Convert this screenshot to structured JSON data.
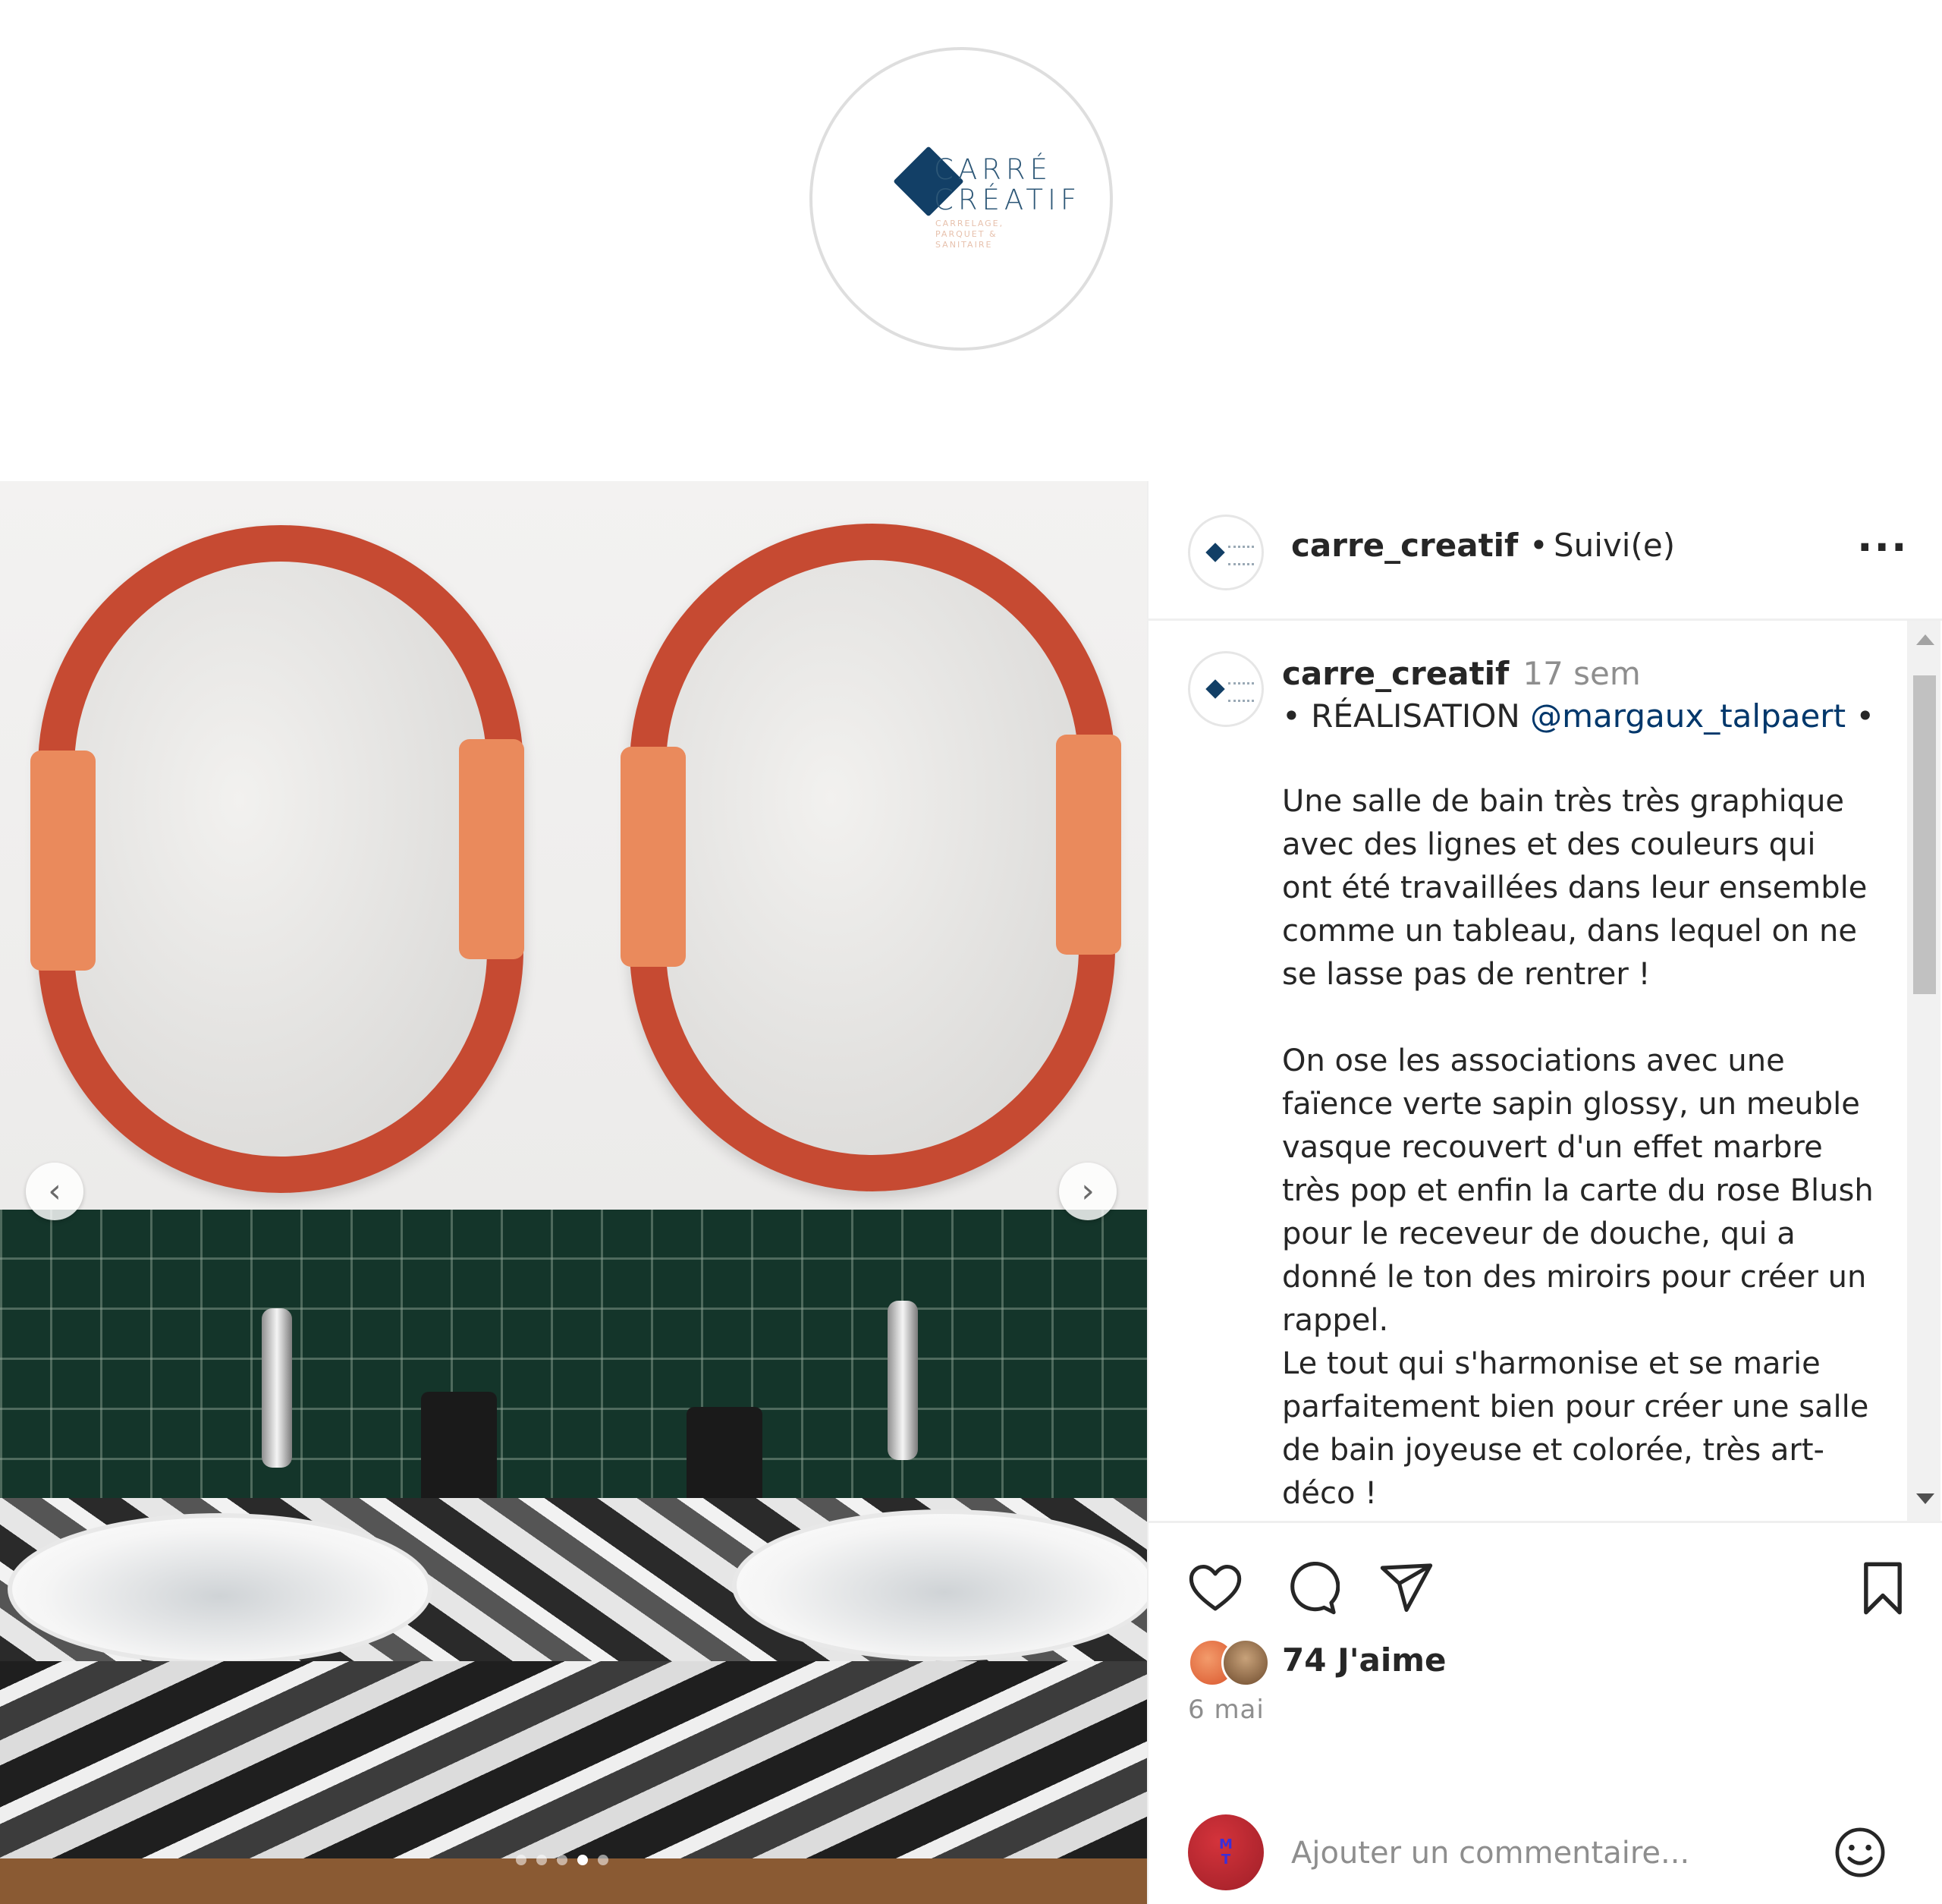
{
  "brand": {
    "logo_line1": "CARRÉ",
    "logo_line2": "CRÉATIF",
    "logo_sub": "CARRELAGE, PARQUET & SANITAIRE",
    "accent": "#123f66"
  },
  "post": {
    "username": "carre_creatif",
    "separator": "•",
    "follow_status": "Suivi(e)",
    "more": "...",
    "slides_total": 5,
    "slide_active": 4
  },
  "caption": {
    "username": "carre_creatif",
    "time": "17 sem",
    "line1_pre": "• RÉALISATION ",
    "mention": "@margaux_talpaert",
    "line1_post": " •",
    "p1": "Une salle de bain très très graphique avec des lignes et des couleurs qui ont été travaillées dans leur ensemble comme un tableau, dans lequel on ne se lasse pas de rentrer !",
    "p2": "On ose les associations avec une faïence verte sapin glossy, un meuble vasque recouvert d'un effet marbre très pop et enfin la carte du rose Blush pour le receveur de douche, qui a donné le ton des miroirs pour créer un rappel.",
    "p3": "Le tout qui s'harmonise et se marie parfaitement bien pour créer une salle de bain joyeuse et colorée, très art-déco !"
  },
  "engagement": {
    "likes_label": "74 J'aime",
    "date": "6 mai",
    "me_initials": "M T"
  },
  "comment": {
    "placeholder": "Ajouter un commentaire..."
  },
  "icons": {
    "prev": "chevron-left-icon",
    "next": "chevron-right-icon",
    "like": "heart-icon",
    "comment": "comment-bubble-icon",
    "share": "paper-plane-icon",
    "save": "bookmark-icon",
    "emoji": "smiley-icon"
  }
}
